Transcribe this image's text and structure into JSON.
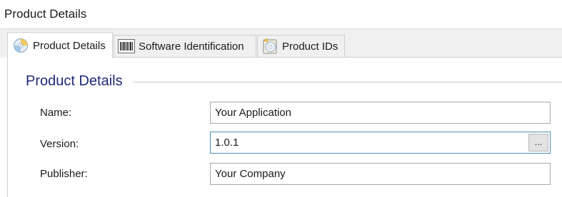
{
  "window": {
    "title": "Product Details"
  },
  "tabs": [
    {
      "label": "Product Details",
      "icon": "cd-disc-icon",
      "active": true
    },
    {
      "label": "Software Identification",
      "icon": "barcode-icon",
      "active": false
    },
    {
      "label": "Product IDs",
      "icon": "disc-case-icon",
      "active": false
    }
  ],
  "section": {
    "title": "Product Details"
  },
  "fields": {
    "name": {
      "label": "Name:",
      "value": "Your Application"
    },
    "version": {
      "label": "Version:",
      "value": "1.0.1",
      "button_label": "..."
    },
    "publisher": {
      "label": "Publisher:",
      "value": "Your Company"
    }
  },
  "colors": {
    "section_title": "#1f2a7a",
    "focus_border": "#4a8fb0"
  }
}
